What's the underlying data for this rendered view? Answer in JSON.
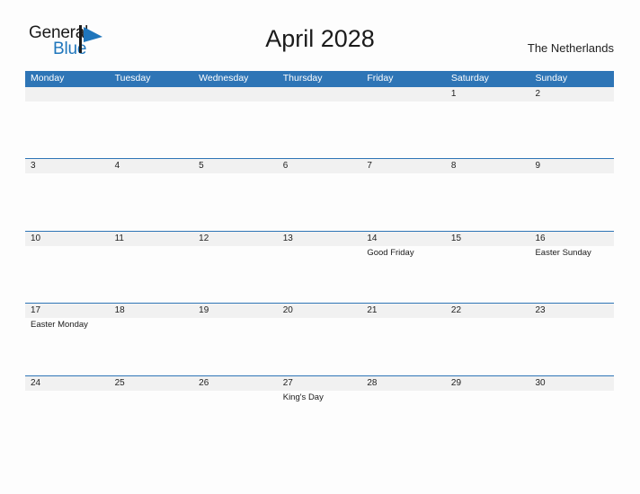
{
  "brand": {
    "name_part1": "General",
    "name_part2": "Blue",
    "mark_icon": "sail-triangle-icon",
    "accent_color": "#1f76bc"
  },
  "header": {
    "title": "April 2028",
    "region": "The Netherlands"
  },
  "calendar": {
    "header_bg_color": "#2e75b6",
    "row_divider_color": "#2e75b6",
    "date_band_color": "#f1f1f1",
    "weekdays": [
      "Monday",
      "Tuesday",
      "Wednesday",
      "Thursday",
      "Friday",
      "Saturday",
      "Sunday"
    ],
    "weeks": [
      [
        {
          "date": "",
          "events": []
        },
        {
          "date": "",
          "events": []
        },
        {
          "date": "",
          "events": []
        },
        {
          "date": "",
          "events": []
        },
        {
          "date": "",
          "events": []
        },
        {
          "date": "1",
          "events": []
        },
        {
          "date": "2",
          "events": []
        }
      ],
      [
        {
          "date": "3",
          "events": []
        },
        {
          "date": "4",
          "events": []
        },
        {
          "date": "5",
          "events": []
        },
        {
          "date": "6",
          "events": []
        },
        {
          "date": "7",
          "events": []
        },
        {
          "date": "8",
          "events": []
        },
        {
          "date": "9",
          "events": []
        }
      ],
      [
        {
          "date": "10",
          "events": []
        },
        {
          "date": "11",
          "events": []
        },
        {
          "date": "12",
          "events": []
        },
        {
          "date": "13",
          "events": []
        },
        {
          "date": "14",
          "events": [
            "Good Friday"
          ]
        },
        {
          "date": "15",
          "events": []
        },
        {
          "date": "16",
          "events": [
            "Easter Sunday"
          ]
        }
      ],
      [
        {
          "date": "17",
          "events": [
            "Easter Monday"
          ]
        },
        {
          "date": "18",
          "events": []
        },
        {
          "date": "19",
          "events": []
        },
        {
          "date": "20",
          "events": []
        },
        {
          "date": "21",
          "events": []
        },
        {
          "date": "22",
          "events": []
        },
        {
          "date": "23",
          "events": []
        }
      ],
      [
        {
          "date": "24",
          "events": []
        },
        {
          "date": "25",
          "events": []
        },
        {
          "date": "26",
          "events": []
        },
        {
          "date": "27",
          "events": [
            "King's Day"
          ]
        },
        {
          "date": "28",
          "events": []
        },
        {
          "date": "29",
          "events": []
        },
        {
          "date": "30",
          "events": []
        }
      ]
    ]
  }
}
